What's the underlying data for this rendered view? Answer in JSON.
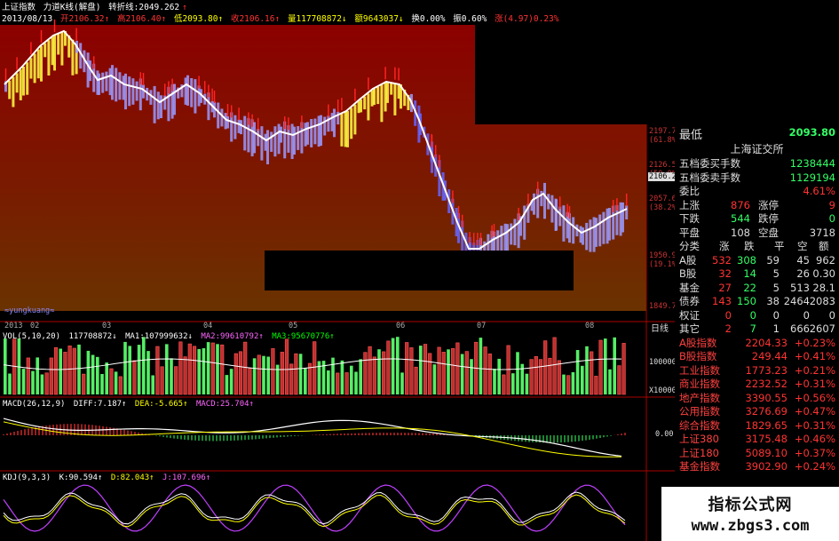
{
  "info": {
    "title": "上证指数",
    "indicator": "力道K线(解盘)",
    "turn_label": "转折线:",
    "turn_value": "2049.262",
    "date": "2013/08/13",
    "open": "开2106.32↑",
    "high": "高2106.40↑",
    "low": "低2093.80↑",
    "close": "收2106.16↑",
    "volume": "量117708872↓",
    "amount": "额9643037↓",
    "turnover": "换0.00%",
    "amplitude": "振0.60%",
    "change": "涨(4.97)0.23%"
  },
  "price_axis": [
    {
      "value": "2197.7",
      "pct": "(61.8%)"
    },
    {
      "value": "2126.5",
      "pct": "(50.0%)"
    },
    {
      "value": "2106.2",
      "pct": ""
    },
    {
      "value": "2057.6",
      "pct": "(38.2%)"
    },
    {
      "value": "1950.9",
      "pct": "(19.1%)"
    },
    {
      "value": "1849.7",
      "pct": "(0.0%)"
    }
  ],
  "time_axis": {
    "labels": [
      "2013",
      "02",
      "03",
      "04",
      "05",
      "06",
      "07",
      "08"
    ],
    "period": "日线"
  },
  "watermark_id": "≈yungkuang≈",
  "vol": {
    "name": "VOL(5,10,20)",
    "val": "117708872↓",
    "ma1": "MA1:107999632↓",
    "ma2": "MA2:99610792↑",
    "ma3": "MA3:95670776↑",
    "axis_top": "100000",
    "axis_bottom": "X10000"
  },
  "macd": {
    "name": "MACD(26,12,9)",
    "diff": "DIFF:7.187↑",
    "dea": "DEA:-5.665↑",
    "macd": "MACD:25.704↑",
    "axis": "0.00"
  },
  "kdj": {
    "name": "KDJ(9,3,3)",
    "k": "K:90.594↑",
    "d": "D:82.043↑",
    "j": "J:107.696↑"
  },
  "side": {
    "lowest_label": "最低",
    "lowest_value": "2093.80",
    "exchange": "上海证交所",
    "rows1": [
      {
        "label": "五档委买手数",
        "value": "1238444"
      },
      {
        "label": "五档委卖手数",
        "value": "1129194"
      },
      {
        "label": "委比",
        "value": "4.61%"
      }
    ],
    "updown": [
      {
        "l1": "上涨",
        "v1": "876",
        "l2": "涨停",
        "v2": "9"
      },
      {
        "l1": "下跌",
        "v1": "544",
        "l2": "跌停",
        "v2": "0"
      },
      {
        "l1": "平盘",
        "v1": "108",
        "l2": "空盘",
        "v2": "3718"
      }
    ],
    "class_header": [
      "分类",
      "涨",
      "跌",
      "平",
      "空",
      "额"
    ],
    "class_rows": [
      {
        "name": "A股",
        "c": [
          "532",
          "308",
          "59",
          "45",
          "962"
        ]
      },
      {
        "name": "B股",
        "c": [
          "32",
          "14",
          "5",
          "26",
          "0.30"
        ]
      },
      {
        "name": "基金",
        "c": [
          "27",
          "22",
          "5",
          "513",
          "28.1"
        ]
      },
      {
        "name": "债券",
        "c": [
          "143",
          "150",
          "38",
          "2464",
          "2083"
        ]
      },
      {
        "name": "权证",
        "c": [
          "0",
          "0",
          "0",
          "0",
          "0"
        ]
      },
      {
        "name": "其它",
        "c": [
          "2",
          "7",
          "1",
          "666",
          "2607"
        ]
      }
    ],
    "indices": [
      {
        "name": "A股指数",
        "value": "2204.33",
        "chg": "+0.23%"
      },
      {
        "name": "B股指数",
        "value": "249.44",
        "chg": "+0.41%"
      },
      {
        "name": "工业指数",
        "value": "1773.23",
        "chg": "+0.21%"
      },
      {
        "name": "商业指数",
        "value": "2232.52",
        "chg": "+0.31%"
      },
      {
        "name": "地产指数",
        "value": "3390.55",
        "chg": "+0.56%"
      },
      {
        "name": "公用指数",
        "value": "3276.69",
        "chg": "+0.47%"
      },
      {
        "name": "综合指数",
        "value": "1829.65",
        "chg": "+0.31%"
      },
      {
        "name": "上证380",
        "value": "3175.48",
        "chg": "+0.46%"
      },
      {
        "name": "上证180",
        "value": "5089.10",
        "chg": "+0.37%"
      },
      {
        "name": "基金指数",
        "value": "3902.90",
        "chg": "+0.24%"
      }
    ]
  },
  "brand": {
    "line1": "指标公式网",
    "line2": "www.zbgs3.com"
  },
  "colors": {
    "up": "#ff3333",
    "down": "#33ff66",
    "yellow": "#ffff00",
    "accent_blue": "#8080ff",
    "label_red": "#ff4040"
  }
}
